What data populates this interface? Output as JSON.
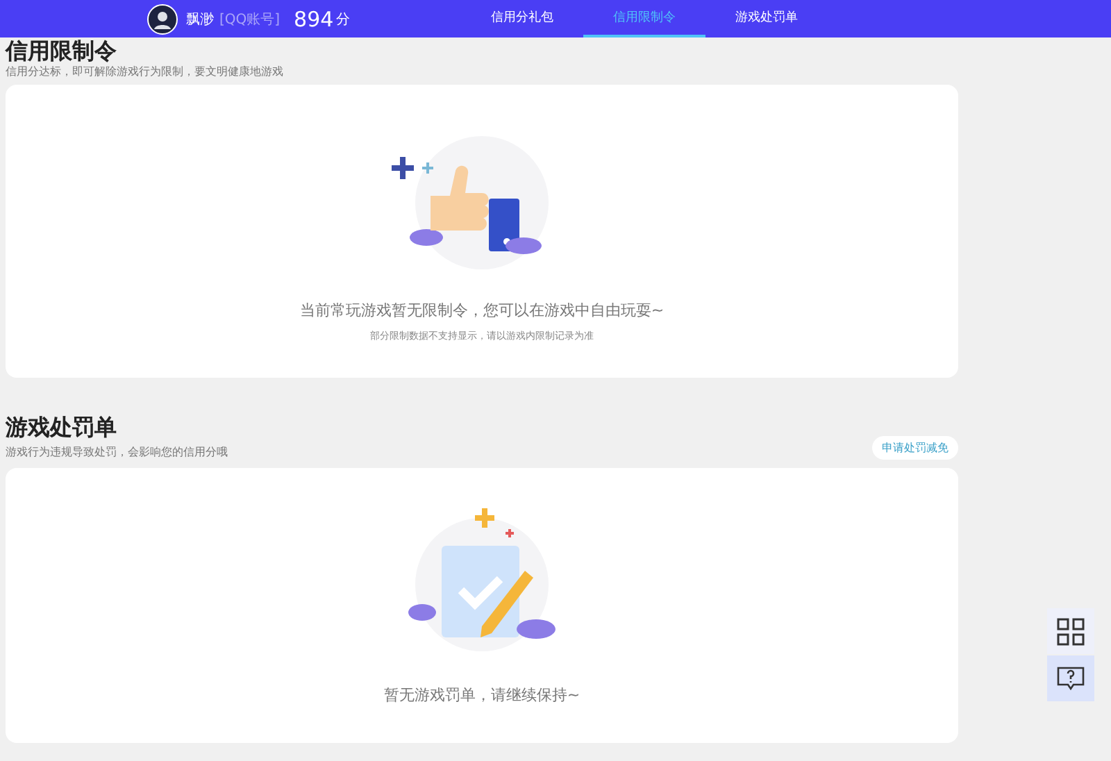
{
  "nav": {
    "user_name": "飘渺",
    "account_type": "[QQ账号]",
    "score": "894",
    "score_unit": "分",
    "tabs": [
      {
        "label": "信用分礼包",
        "selected": false
      },
      {
        "label": "信用限制令",
        "selected": true
      },
      {
        "label": "游戏处罚单",
        "selected": false
      }
    ]
  },
  "restriction_section": {
    "title": "信用限制令",
    "subtitle": "信用分达标，即可解除游戏行为限制，要文明健康地游戏",
    "empty_message": "当前常玩游戏暂无限制令，您可以在游戏中自由玩耍~",
    "empty_note": "部分限制数据不支持显示，请以游戏内限制记录为准"
  },
  "penalty_section": {
    "title": "游戏处罚单",
    "subtitle": "游戏行为违规导致处罚，会影响您的信用分哦",
    "action_button": "申请处罚减免",
    "empty_message": "暂无游戏罚单，请继续保持~"
  }
}
